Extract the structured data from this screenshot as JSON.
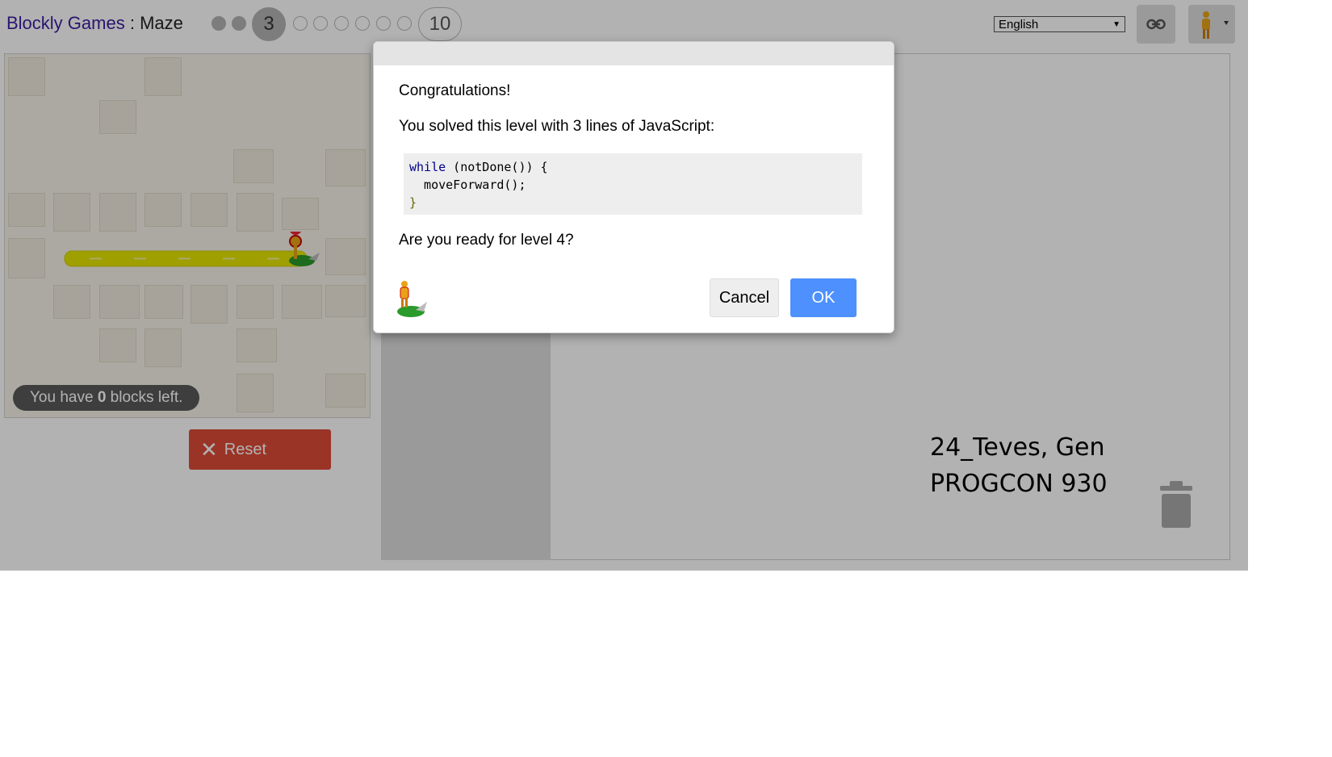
{
  "header": {
    "app_name": "Blockly Games",
    "separator": " : ",
    "game_name": "Maze",
    "current_level": "3",
    "last_level": "10",
    "language": "English"
  },
  "maze": {
    "blocks_left_prefix": "You have ",
    "blocks_left_count": "0",
    "blocks_left_suffix": " blocks left."
  },
  "controls": {
    "reset_label": "Reset"
  },
  "dialog": {
    "title": "Congratulations!",
    "message": "You solved this level with 3 lines of JavaScript:",
    "code": {
      "line1_kw": "while",
      "line1_rest": " (notDone()) {",
      "line2": "  moveForward();",
      "line3": "}"
    },
    "question": "Are you ready for level 4?",
    "cancel_label": "Cancel",
    "ok_label": "OK"
  },
  "caption": {
    "line1": "24_Teves, Gen",
    "line2": "PROGCON 930"
  },
  "colors": {
    "ok_button": "#4d90fe",
    "reset_button": "#dd4b39",
    "path": "#e4e400"
  },
  "icons": [
    "link-icon",
    "pegman-icon",
    "trash-icon",
    "close-icon"
  ]
}
